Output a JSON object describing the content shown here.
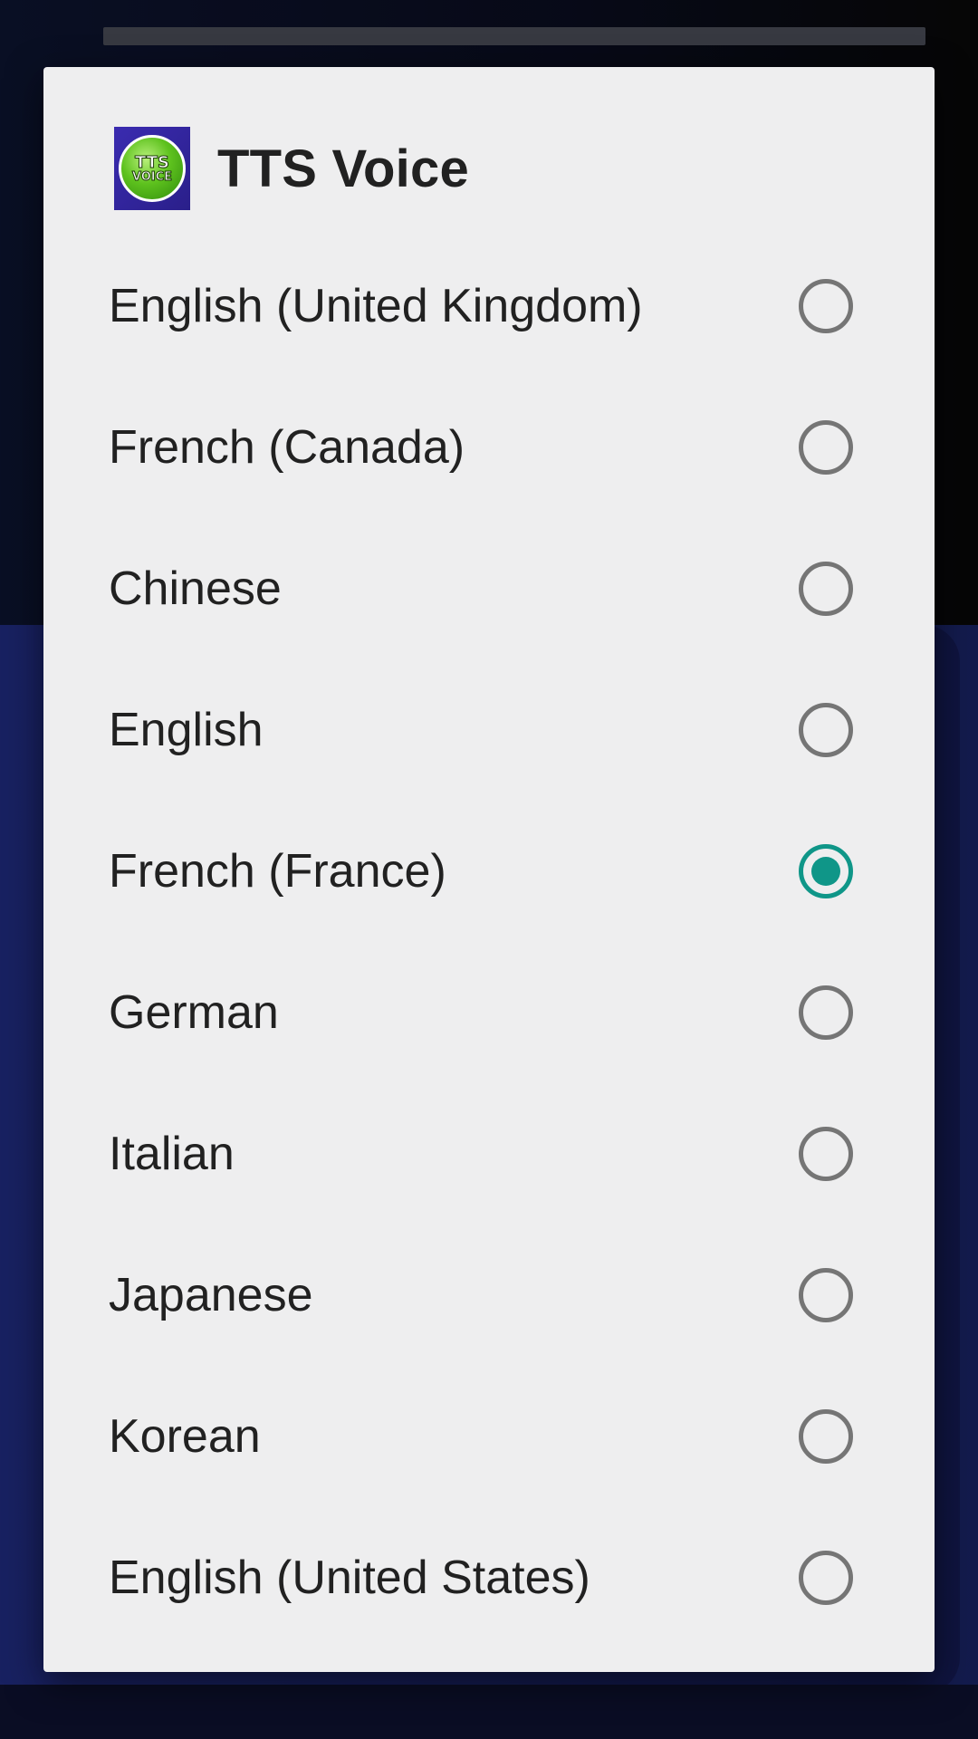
{
  "dialog": {
    "title": "TTS Voice",
    "icon": {
      "name": "tts-voice-app-icon",
      "line1": "TTS",
      "line2": "VOICE"
    },
    "accent_color": "#0f9688",
    "options": [
      {
        "label": "English (United Kingdom)",
        "checked": false
      },
      {
        "label": "French (Canada)",
        "checked": false
      },
      {
        "label": "Chinese",
        "checked": false
      },
      {
        "label": "English",
        "checked": false
      },
      {
        "label": "French (France)",
        "checked": true
      },
      {
        "label": "German",
        "checked": false
      },
      {
        "label": "Italian",
        "checked": false
      },
      {
        "label": "Japanese",
        "checked": false
      },
      {
        "label": "Korean",
        "checked": false
      },
      {
        "label": "English (United States)",
        "checked": false
      }
    ]
  }
}
